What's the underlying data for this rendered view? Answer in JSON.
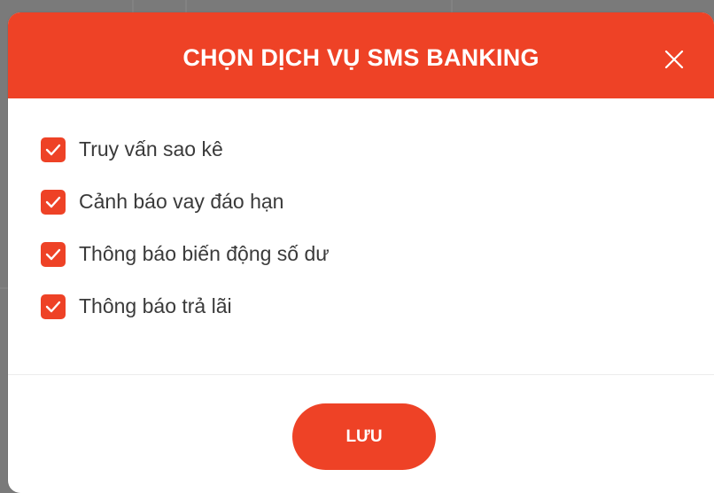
{
  "dialog": {
    "title": "CHỌN DỊCH VỤ SMS BANKING",
    "close_icon": "close-icon",
    "options": [
      {
        "label": "Truy vấn sao kê",
        "checked": true
      },
      {
        "label": "Cảnh báo vay đáo hạn",
        "checked": true
      },
      {
        "label": "Thông báo biến động số dư",
        "checked": true
      },
      {
        "label": "Thông báo trả lãi",
        "checked": true
      }
    ],
    "save_label": "LƯU"
  },
  "colors": {
    "accent": "#ee4226",
    "text": "#3a3a3a",
    "backdrop": "#7a7a7a"
  }
}
